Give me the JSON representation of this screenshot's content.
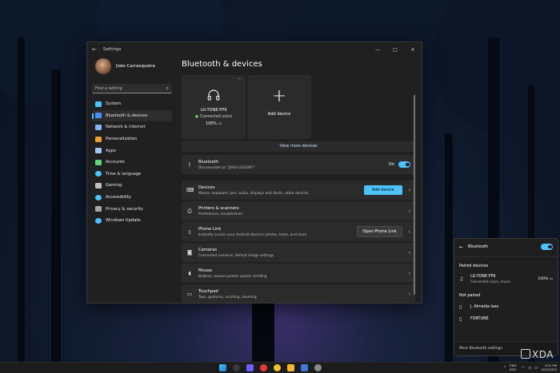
{
  "window": {
    "title": "Settings",
    "controls": {
      "minimize": "—",
      "maximize": "□",
      "close": "✕"
    }
  },
  "nav": {
    "user_name": "João Carrasqueira",
    "search_placeholder": "Find a setting",
    "items": [
      {
        "label": "System",
        "icon": "system-icon",
        "color": "#4cc2ff"
      },
      {
        "label": "Bluetooth & devices",
        "icon": "bluetooth-icon",
        "color": "#4c8fff",
        "active": true
      },
      {
        "label": "Network & internet",
        "icon": "network-icon",
        "color": "#7fb6ff"
      },
      {
        "label": "Personalization",
        "icon": "brush-icon",
        "color": "#f0a030"
      },
      {
        "label": "Apps",
        "icon": "apps-icon",
        "color": "#9ec8ff"
      },
      {
        "label": "Accounts",
        "icon": "accounts-icon",
        "color": "#5ed67a"
      },
      {
        "label": "Time & language",
        "icon": "globe-icon",
        "color": "#4cc2ff"
      },
      {
        "label": "Gaming",
        "icon": "gaming-icon",
        "color": "#c0c0c0"
      },
      {
        "label": "Accessibility",
        "icon": "accessibility-icon",
        "color": "#4cc2ff"
      },
      {
        "label": "Privacy & security",
        "icon": "shield-icon",
        "color": "#a8a8a8"
      },
      {
        "label": "Windows Update",
        "icon": "update-icon",
        "color": "#4cc2ff"
      }
    ]
  },
  "main": {
    "title": "Bluetooth & devices",
    "device_card": {
      "name": "LG-TONE-FP9",
      "status": "Connected voice",
      "battery": "100%",
      "more": "···"
    },
    "add_card": {
      "label": "Add device",
      "plus": "+"
    },
    "view_more": "View more devices",
    "bluetooth_row": {
      "title": "Bluetooth",
      "subtitle": "Discoverable as \"JOAO-LEGION7\"",
      "toggle_label": "On"
    },
    "rows": [
      {
        "key": "devices",
        "title": "Devices",
        "subtitle": "Mouse, keyboard, pen, audio, displays and docks, other devices",
        "button": "Add device",
        "icon": "devices-icon"
      },
      {
        "key": "printers",
        "title": "Printers & scanners",
        "subtitle": "Preferences, troubleshoot",
        "icon": "printer-icon"
      },
      {
        "key": "phone",
        "title": "Phone Link",
        "subtitle": "Instantly access your Android device's photos, texts, and more",
        "button": "Open Phone Link",
        "icon": "phone-icon"
      },
      {
        "key": "cameras",
        "title": "Cameras",
        "subtitle": "Connected cameras, default image settings",
        "icon": "camera-icon"
      },
      {
        "key": "mouse",
        "title": "Mouse",
        "subtitle": "Buttons, mouse pointer speed, scrolling",
        "icon": "mouse-icon"
      },
      {
        "key": "touchpad",
        "title": "Touchpad",
        "subtitle": "Taps, gestures, scrolling, zooming",
        "icon": "touchpad-icon"
      }
    ]
  },
  "flyout": {
    "title": "Bluetooth",
    "paired_heading": "Paired devices",
    "paired": [
      {
        "name": "LG-TONE-FP9",
        "status": "Connected voice, music",
        "battery": "100%"
      }
    ],
    "not_paired_heading": "Not paired",
    "not_paired": [
      {
        "name": "J. Almeida laso"
      },
      {
        "name": "FORTUNE"
      }
    ],
    "footer": "More Bluetooth settings"
  },
  "taskbar": {
    "lang_top": "ENG",
    "lang_bottom": "INTL",
    "time": "4:51 PM",
    "date": "2/22/2023"
  },
  "watermark": "XDA"
}
